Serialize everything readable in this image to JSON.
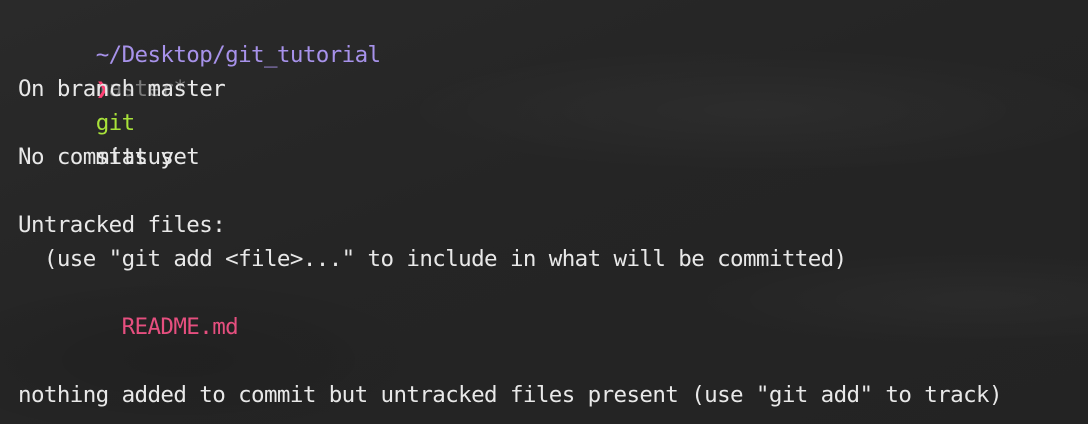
{
  "prompt_header": {
    "path": "~/Desktop/git_tutorial",
    "branch": "master*"
  },
  "command": {
    "prompt_symbol": "❯",
    "executable": "git",
    "args": "status"
  },
  "output": {
    "branch_line": "On branch master",
    "commits_line": "No commits yet",
    "untracked_header": "Untracked files:",
    "untracked_hint": "  (use \"git add <file>...\" to include in what will be committed)",
    "untracked_files": [
      "        README.md"
    ],
    "summary": "nothing added to commit but untracked files present (use \"git add\" to track)"
  },
  "colors": {
    "background": "#262626",
    "path": "#a792ea",
    "branch": "#7a7a7a",
    "prompt_symbol": "#ff3f73",
    "command": "#a8e23a",
    "text": "#e8e8e8",
    "untracked_file": "#e64f7f"
  }
}
